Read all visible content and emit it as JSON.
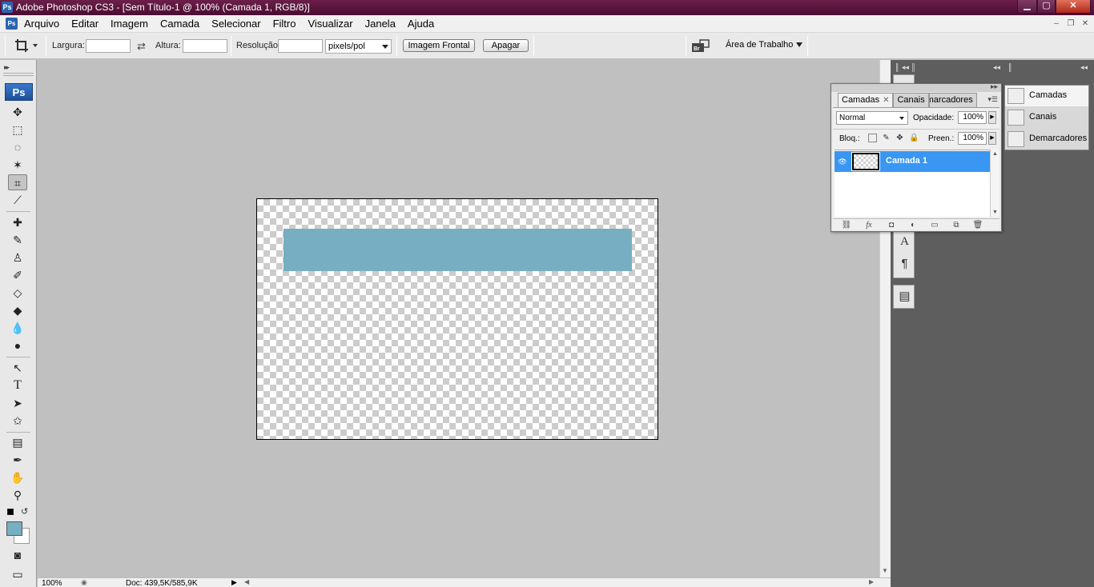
{
  "window": {
    "app_icon": "Ps",
    "title": "Adobe Photoshop CS3 - [Sem Título-1 @ 100% (Camada 1, RGB/8)]",
    "title_color": "#4a0d31"
  },
  "menu": {
    "items": [
      "Arquivo",
      "Editar",
      "Imagem",
      "Camada",
      "Selecionar",
      "Filtro",
      "Visualizar",
      "Janela",
      "Ajuda"
    ]
  },
  "options": {
    "tool_icon": "crop-icon",
    "width_label": "Largura:",
    "width_value": "",
    "height_label": "Altura:",
    "height_value": "",
    "resolution_label": "Resolução:",
    "resolution_value": "",
    "units": "pixels/pol",
    "front_image_label": "Imagem Frontal",
    "clear_label": "Apagar",
    "workspace_label": "Área de Trabalho"
  },
  "toolbox": {
    "logo": "Ps",
    "foreground_color": "#77aec2",
    "background_color": "#ffffff"
  },
  "document": {
    "shape_color": "#77aec2"
  },
  "status": {
    "zoom": "100%",
    "doc_size": "Doc: 439,5K/585,9K"
  },
  "layers_panel": {
    "tabs": [
      "Camadas",
      "Canais",
      "Demarcadores"
    ],
    "tab_layers": "Camadas",
    "tab_channels": "Canais",
    "tab_paths": "Demarcadores",
    "blend_mode": "Normal",
    "opacity_label": "Opacidade:",
    "opacity_value": "100%",
    "lock_label": "Bloq.:",
    "fill_label": "Preen.:",
    "fill_value": "100%",
    "layer_name": "Camada 1",
    "selected_color": "#3996f3"
  },
  "collapsed_panels": {
    "layers": "Camadas",
    "channels": "Canais",
    "paths": "Demarcadores"
  }
}
